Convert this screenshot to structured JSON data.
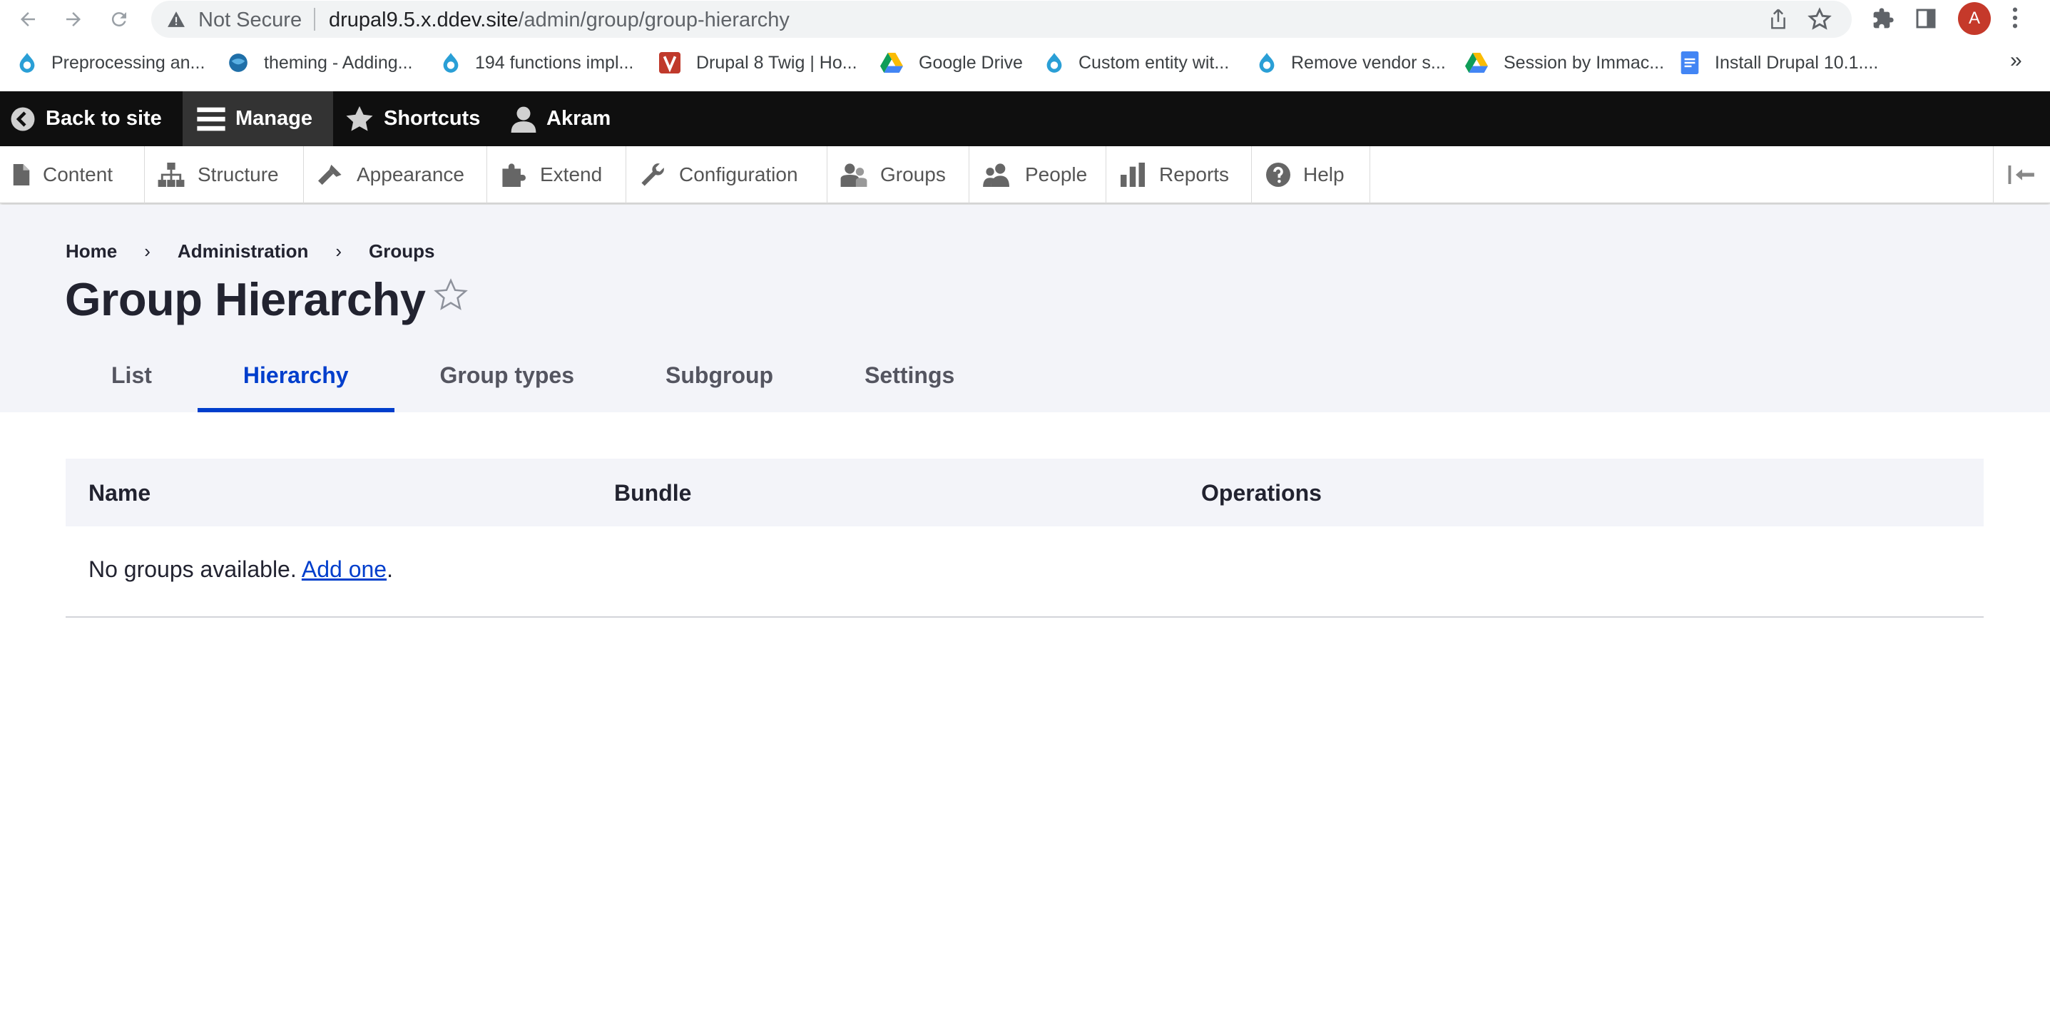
{
  "browser": {
    "security_label": "Not Secure",
    "url_host": "drupal9.5.x.ddev.site",
    "url_path": "/admin/group/group-hierarchy",
    "profile_initial": "A",
    "bookmarks": [
      "Preprocessing an...",
      "theming - Adding...",
      "194 functions impl...",
      "Drupal 8 Twig | Ho...",
      "Google Drive",
      "Custom entity wit...",
      "Remove vendor s...",
      "Session by Immac...",
      "Install Drupal 10.1...."
    ],
    "bookmarks_more": "»"
  },
  "toolbar": {
    "back_to_site": "Back to site",
    "manage": "Manage",
    "shortcuts": "Shortcuts",
    "user": "Akram"
  },
  "tray": {
    "items": [
      "Content",
      "Structure",
      "Appearance",
      "Extend",
      "Configuration",
      "Groups",
      "People",
      "Reports",
      "Help"
    ]
  },
  "breadcrumb": [
    "Home",
    "Administration",
    "Groups"
  ],
  "page": {
    "title": "Group Hierarchy",
    "fav_star": "☆"
  },
  "tabs": [
    "List",
    "Hierarchy",
    "Group types",
    "Subgroup",
    "Settings"
  ],
  "table": {
    "columns": [
      "Name",
      "Bundle",
      "Operations"
    ],
    "empty_text": "No groups available.",
    "add_link": "Add one",
    "empty_suffix": "."
  },
  "colors": {
    "accent": "#003ecc",
    "toolbar_bg": "#0f0f0f",
    "header_bg": "#f3f4f9"
  }
}
